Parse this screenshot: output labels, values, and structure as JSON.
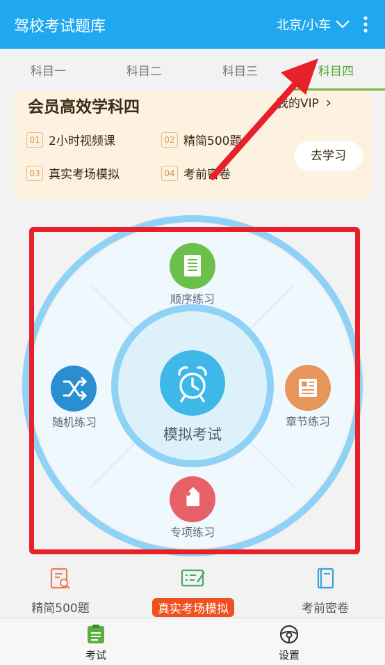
{
  "appbar": {
    "title": "驾校考试题库",
    "city": "北京/小车"
  },
  "tabs": [
    {
      "label": "科目一"
    },
    {
      "label": "科目二"
    },
    {
      "label": "科目三"
    },
    {
      "label": "科目四",
      "active": true
    }
  ],
  "vip": {
    "title": "会员高效学科四",
    "my_vip": "我的VIP",
    "items": [
      {
        "num": "01",
        "label": "2小时视频课"
      },
      {
        "num": "02",
        "label": "精简500题"
      },
      {
        "num": "03",
        "label": "真实考场模拟"
      },
      {
        "num": "04",
        "label": "考前密卷"
      }
    ],
    "go_label": "去学习"
  },
  "wheel": {
    "center": "模拟考试",
    "top": "顺序练习",
    "left": "随机练习",
    "right": "章节练习",
    "bottom": "专项练习"
  },
  "quick": [
    {
      "label": "精简500题"
    },
    {
      "label": "真实考场模拟",
      "highlight": true
    },
    {
      "label": "考前密卷"
    }
  ],
  "bottom_nav": [
    {
      "label": "考试",
      "active": true
    },
    {
      "label": "设置"
    }
  ],
  "colors": {
    "appbar": "#1fa7f0",
    "tab_active": "#5aa62e",
    "vip_bg": "#fdf1e0",
    "green_node": "#6cc04a",
    "blue_node": "#2a8fd0",
    "orange_node": "#e8955a",
    "red_node": "#e86068",
    "center_node": "#3db8e8",
    "highlight": "#f0501f",
    "annotation": "#e8202a"
  }
}
